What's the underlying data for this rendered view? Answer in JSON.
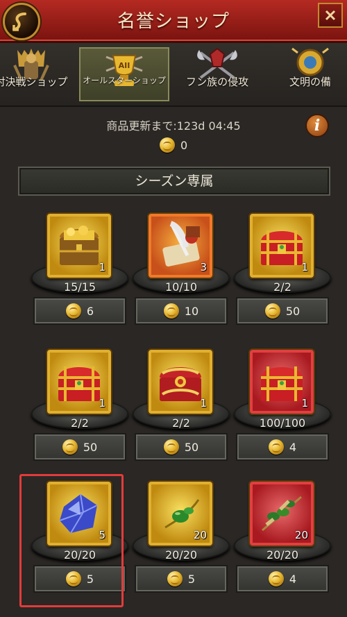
{
  "header": {
    "title": "名誉ショップ"
  },
  "tabs": [
    {
      "label": "対決戦ショップ",
      "emblem": "armor-emblem-icon"
    },
    {
      "label": "オールスターショップ",
      "emblem": "trophy-emblem-icon",
      "active": true
    },
    {
      "label": "フン族の侵攻",
      "emblem": "crossed-axes-emblem-icon"
    },
    {
      "label": "文明の備",
      "emblem": "crest-emblem-icon"
    }
  ],
  "info": {
    "refresh_text": "商品更新まで:123d 04:45",
    "balance": "0"
  },
  "section": {
    "title": "シーズン専属"
  },
  "items": [
    {
      "icon": "treasure-chest-gold-icon",
      "frame": "gold",
      "qty": "1",
      "stock": "15/15",
      "price": "6"
    },
    {
      "icon": "scroll-quill-icon",
      "frame": "orange",
      "qty": "3",
      "stock": "10/10",
      "price": "10"
    },
    {
      "icon": "red-chest-icon",
      "frame": "gold",
      "qty": "1",
      "stock": "2/2",
      "price": "50"
    },
    {
      "icon": "red-chest-icon",
      "frame": "gold",
      "qty": "1",
      "stock": "2/2",
      "price": "50"
    },
    {
      "icon": "ornate-chest-icon",
      "frame": "gold",
      "qty": "1",
      "stock": "2/2",
      "price": "50"
    },
    {
      "icon": "red-chest-icon",
      "frame": "red",
      "qty": "1",
      "stock": "100/100",
      "price": "4"
    },
    {
      "icon": "blue-crystal-icon",
      "frame": "gold",
      "qty": "5",
      "stock": "20/20",
      "price": "5"
    },
    {
      "icon": "green-olive-icon",
      "frame": "gold",
      "qty": "20",
      "stock": "20/20",
      "price": "5"
    },
    {
      "icon": "olive-branch-icon",
      "frame": "red",
      "qty": "20",
      "stock": "20/20",
      "price": "4"
    }
  ]
}
